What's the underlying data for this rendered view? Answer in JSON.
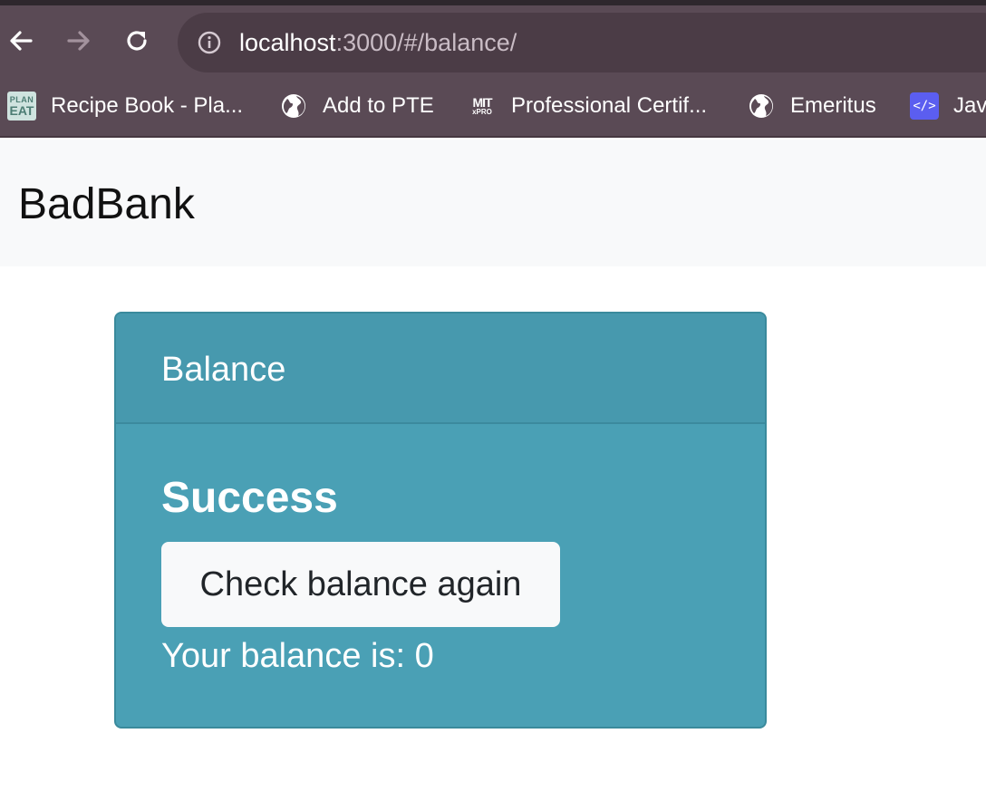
{
  "browser": {
    "url_host": "localhost",
    "url_path": ":3000/#/balance/",
    "bookmarks": [
      {
        "label": "Recipe Book - Pla...",
        "icon": "planeat-icon"
      },
      {
        "label": "Add to PTE",
        "icon": "globe-icon"
      },
      {
        "label": "Professional Certif...",
        "icon": "mit-xpro-icon"
      },
      {
        "label": "Emeritus",
        "icon": "globe-icon"
      },
      {
        "label": "Jav",
        "icon": "code-icon"
      }
    ],
    "planeat_icon_text": [
      "PLAN",
      "EAT"
    ],
    "mit_icon_text": [
      "MIT",
      "xPRO"
    ],
    "code_icon_text": "</>"
  },
  "navbar": {
    "brand": "BadBank"
  },
  "card": {
    "header": "Balance",
    "status": "Success",
    "button_label": "Check balance again",
    "balance_text": "Your balance is: 0"
  },
  "colors": {
    "chrome": "#5a4a55",
    "omnibox": "#4b3c46",
    "card_bg": "#4aa0b5",
    "card_header_bg": "#4799ae",
    "navbar_bg": "#f8f9fa"
  }
}
